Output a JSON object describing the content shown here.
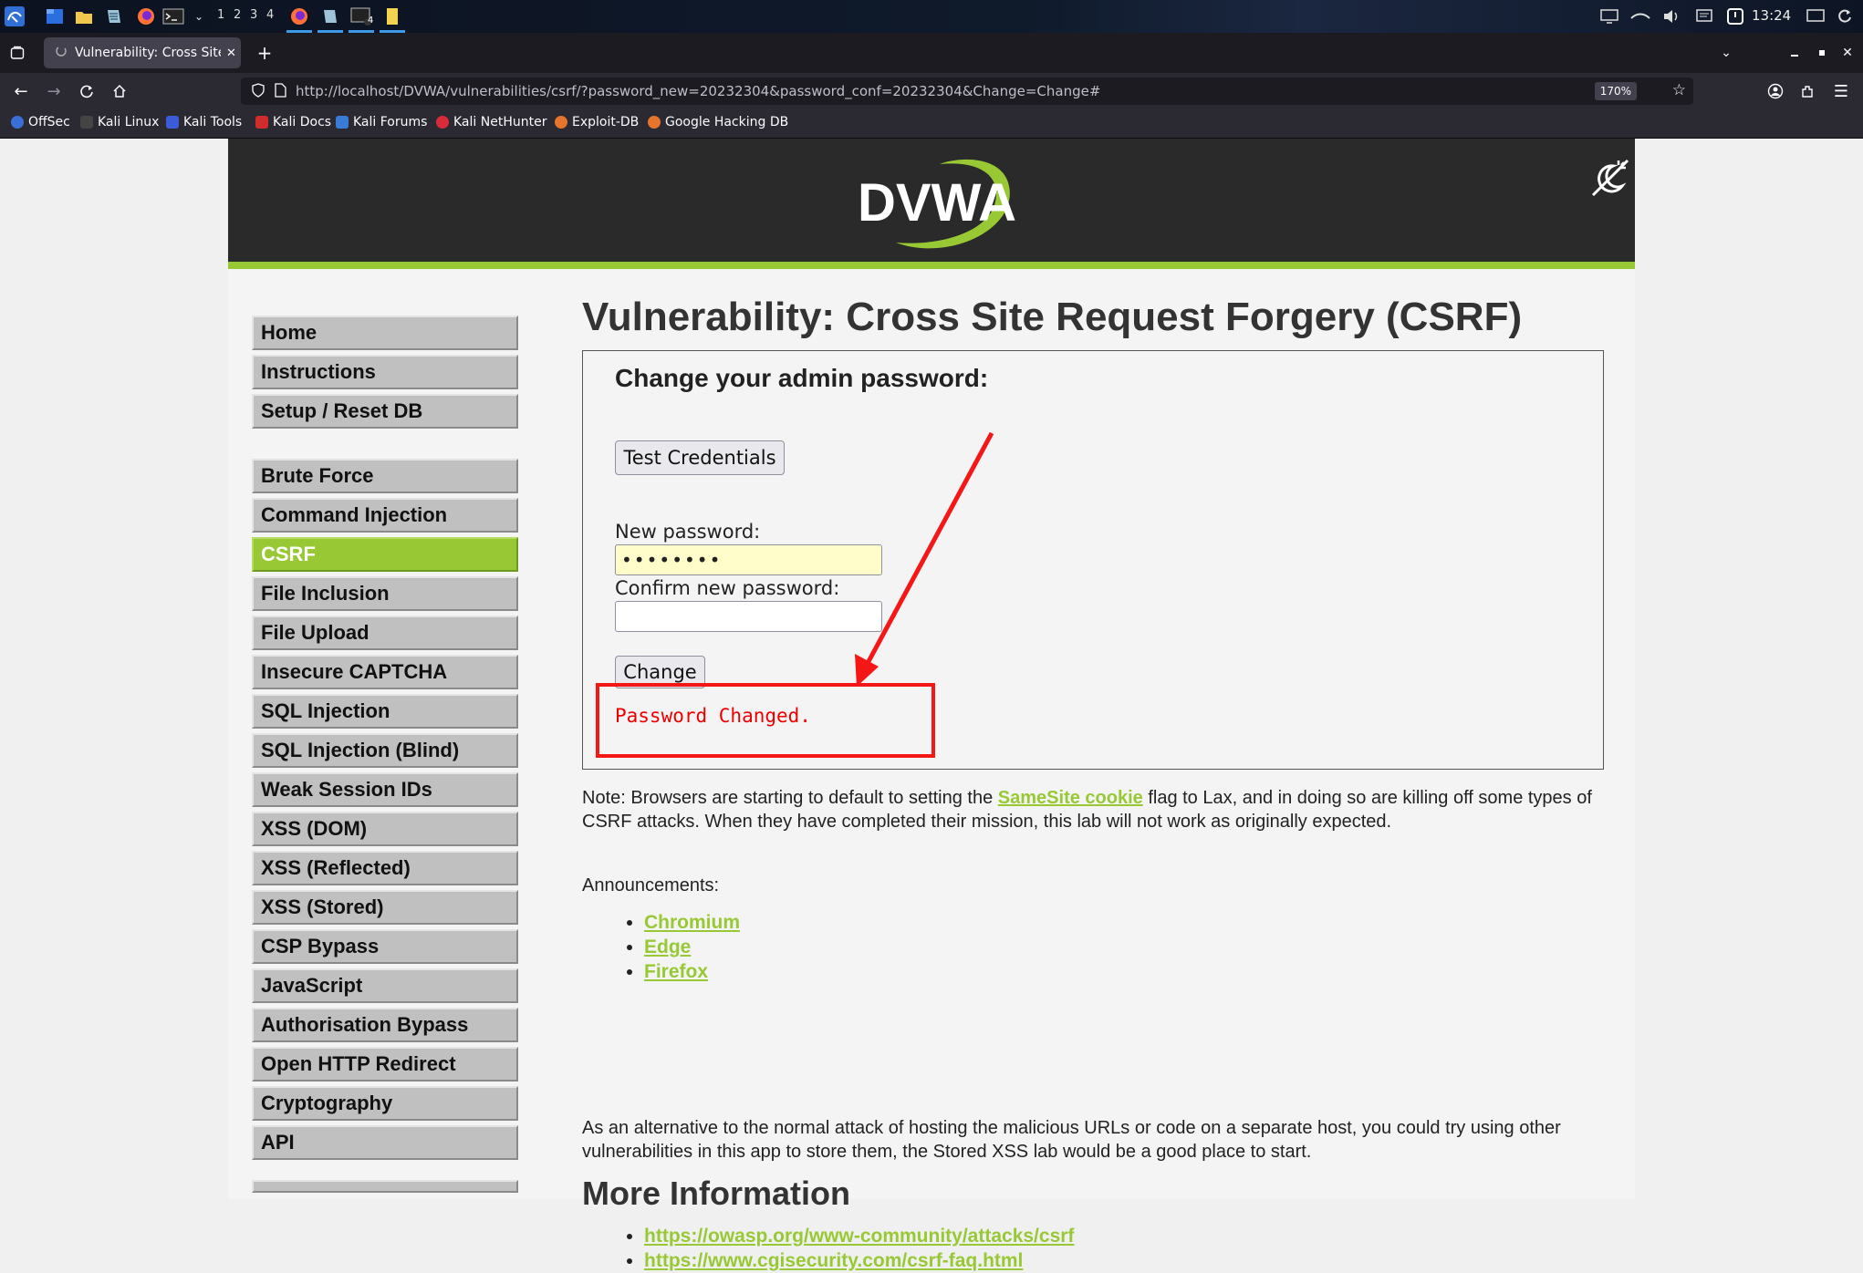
{
  "taskbar": {
    "workspaces": [
      "1",
      "2",
      "3",
      "4"
    ],
    "clock": "13:24",
    "terminal_badge": "4"
  },
  "browser": {
    "tab_title": "Vulnerability: Cross Site R",
    "url_host": "http://localhost",
    "url_path": "/DVWA/vulnerabilities/csrf/?password_new=20232304&password_conf=20232304&Change=Change#",
    "zoom": "170%",
    "bookmarks": [
      "OffSec",
      "Kali Linux",
      "Kali Tools",
      "Kali Docs",
      "Kali Forums",
      "Kali NetHunter",
      "Exploit-DB",
      "Google Hacking DB"
    ]
  },
  "logo_text": "DVWA",
  "sidebar": {
    "group1": [
      "Home",
      "Instructions",
      "Setup / Reset DB"
    ],
    "group2": [
      "Brute Force",
      "Command Injection",
      "CSRF",
      "File Inclusion",
      "File Upload",
      "Insecure CAPTCHA",
      "SQL Injection",
      "SQL Injection (Blind)",
      "Weak Session IDs",
      "XSS (DOM)",
      "XSS (Reflected)",
      "XSS (Stored)",
      "CSP Bypass",
      "JavaScript",
      "Authorisation Bypass",
      "Open HTTP Redirect",
      "Cryptography",
      "API"
    ],
    "selected": "CSRF"
  },
  "main": {
    "title": "Vulnerability: Cross Site Request Forgery (CSRF)",
    "box_title": "Change your admin password:",
    "test_button": "Test Credentials",
    "new_password_label": "New password:",
    "new_password_value": "••••••••",
    "confirm_password_label": "Confirm new password:",
    "confirm_password_value": "",
    "change_button": "Change",
    "result": "Password Changed.",
    "note_prefix": "Note: Browsers are starting to default to setting the ",
    "note_link": "SameSite cookie",
    "note_suffix": " flag to Lax, and in doing so are killing off some types of CSRF attacks. When they have completed their mission, this lab will not work as originally expected.",
    "announcements_label": "Announcements:",
    "announcements": [
      "Chromium",
      "Edge",
      "Firefox"
    ],
    "alt_text": "As an alternative to the normal attack of hosting the malicious URLs or code on a separate host, you could try using other vulnerabilities in this app to store them, the Stored XSS lab would be a good place to start.",
    "more_info_heading": "More Information",
    "more_info_links": [
      "https://owasp.org/www-community/attacks/csrf",
      "https://www.cgisecurity.com/csrf-faq.html"
    ]
  },
  "colors": {
    "accent": "#98c935",
    "annotation": "#f51616",
    "error_text": "#ee0000"
  }
}
